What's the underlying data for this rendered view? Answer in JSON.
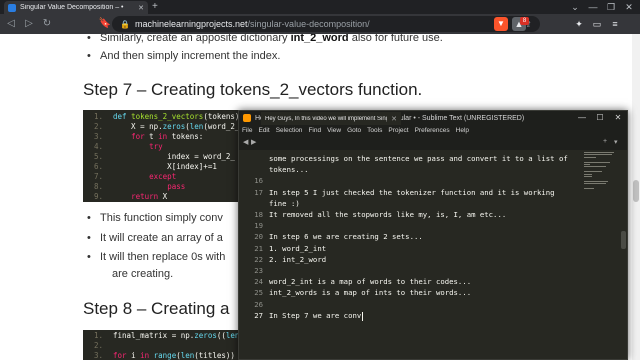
{
  "browser": {
    "tab_title": "Singular Value Decomposition – •",
    "url_host": "machinelearningprojects.net",
    "url_path": "/singular-value-decomposition/",
    "ext_badge": "8"
  },
  "article": {
    "bullets_top": [
      {
        "pre": "Similarly, create an apposite dictionary ",
        "bold": "int_2_word",
        "post": " also for future use."
      },
      {
        "pre": "And then simply increment the index.",
        "bold": "",
        "post": ""
      }
    ],
    "step7_heading": "Step 7 – Creating tokens_2_vectors function.",
    "step7_code": [
      {
        "n": "1.",
        "parts": [
          [
            "kw",
            "def "
          ],
          [
            "fn",
            "tokens_2_vectors"
          ],
          [
            "",
            "(tokens):"
          ]
        ]
      },
      {
        "n": "2.",
        "parts": [
          [
            "",
            "    X = np."
          ],
          [
            "kw",
            "zeros"
          ],
          [
            "",
            "("
          ],
          [
            "kw",
            "len"
          ],
          [
            "",
            "(word_2_"
          ]
        ]
      },
      {
        "n": "3.",
        "parts": [
          [
            "",
            "    "
          ],
          [
            "kw2",
            "for "
          ],
          [
            "",
            "t "
          ],
          [
            "kw2",
            "in "
          ],
          [
            "",
            "tokens:"
          ]
        ]
      },
      {
        "n": "4.",
        "parts": [
          [
            "",
            "        "
          ],
          [
            "kw2",
            "try"
          ],
          [
            ":",
            ""
          ]
        ]
      },
      {
        "n": "5.",
        "parts": [
          [
            "",
            "            index = word_2_"
          ]
        ]
      },
      {
        "n": "6.",
        "parts": [
          [
            "",
            "            X[index]+=1"
          ]
        ]
      },
      {
        "n": "7.",
        "parts": [
          [
            "",
            "        "
          ],
          [
            "kw2",
            "except"
          ],
          [
            ":",
            ""
          ]
        ]
      },
      {
        "n": "8.",
        "parts": [
          [
            "",
            "            "
          ],
          [
            "kw2",
            "pass"
          ]
        ]
      },
      {
        "n": "9.",
        "parts": [
          [
            "",
            "    "
          ],
          [
            "kw2",
            "return "
          ],
          [
            "",
            "X"
          ]
        ]
      }
    ],
    "bullets_mid": [
      "This function simply conv",
      "It will create an array of a",
      "It will then replace 0s with",
      "are creating."
    ],
    "step8_heading": "Step 8 – Creating a",
    "step8_code": [
      {
        "n": "1.",
        "parts": [
          [
            "",
            "final_matrix = np."
          ],
          [
            "kw",
            "zeros"
          ],
          [
            "",
            "(("
          ],
          [
            "kw",
            "len"
          ],
          [
            "",
            "("
          ]
        ]
      },
      {
        "n": "2.",
        "parts": [
          [
            "",
            ""
          ]
        ]
      },
      {
        "n": "3.",
        "parts": [
          [
            "kw2",
            "for "
          ],
          [
            "",
            "i "
          ],
          [
            "kw2",
            "in "
          ],
          [
            "kw",
            "range"
          ],
          [
            "",
            "("
          ],
          [
            "kw",
            "len"
          ],
          [
            "",
            "(titles))"
          ]
        ]
      }
    ]
  },
  "sublime": {
    "title": "Hey Guys, In this video we will implement Singular • - Sublime Text (UNREGISTERED)",
    "menu": [
      "File",
      "Edit",
      "Selection",
      "Find",
      "View",
      "Goto",
      "Tools",
      "Project",
      "Preferences",
      "Help"
    ],
    "tab_title": "Hey Guys, In this video we will implement Singular •",
    "lines": [
      {
        "n": "",
        "text": "some processings on the sentence we pass and convert it to a list of"
      },
      {
        "n": "",
        "text": "tokens..."
      },
      {
        "n": "16",
        "text": ""
      },
      {
        "n": "17",
        "text": "In step 5 I just checked the tokenizer function and it is working"
      },
      {
        "n": "",
        "text": "fine :)"
      },
      {
        "n": "18",
        "text": "It removed all the stopwords like my, is, I, am etc..."
      },
      {
        "n": "19",
        "text": ""
      },
      {
        "n": "20",
        "text": "In step 6 we are creating 2 sets..."
      },
      {
        "n": "21",
        "text": "1. word_2_int"
      },
      {
        "n": "22",
        "text": "2. int_2_word"
      },
      {
        "n": "23",
        "text": ""
      },
      {
        "n": "24",
        "text": "word_2_int is a map of words to their codes..."
      },
      {
        "n": "25",
        "text": "int_2_words is a map of ints to their words..."
      },
      {
        "n": "26",
        "text": ""
      },
      {
        "n": "27",
        "text": "In Step 7 we are conv",
        "current": true
      }
    ]
  },
  "colors": {
    "editor_bg": "#272822",
    "code_bg": "#272822",
    "keyword": "#66d9ef",
    "keyword2": "#f92672",
    "function": "#a6e22e"
  }
}
